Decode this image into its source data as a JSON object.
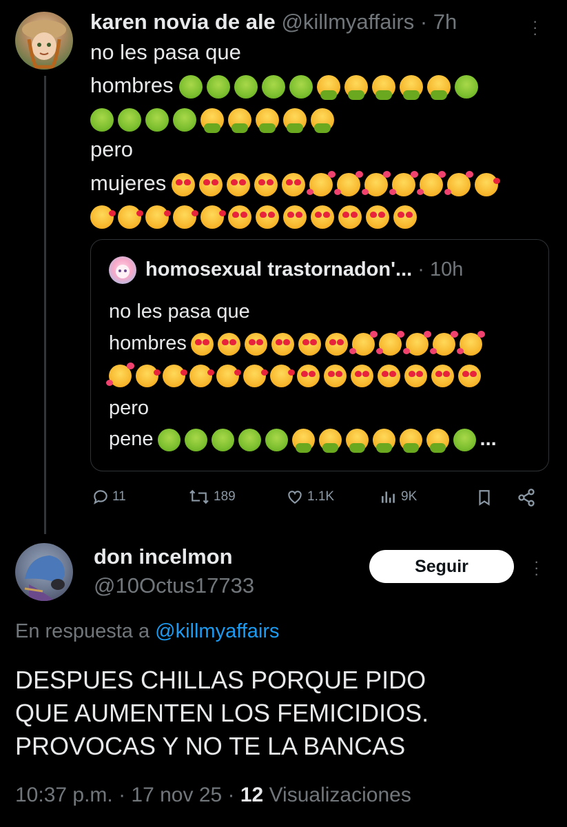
{
  "thread": {
    "author_name": "karen novia de ale",
    "author_handle": "@killmyaffairs",
    "time": "· 7h",
    "lines": [
      "no les pasa que",
      "hombres",
      "pero",
      "mujeres"
    ],
    "emoji_rows": {
      "hombres": [
        "sick",
        "sick",
        "sick",
        "sick",
        "sick",
        "vomit",
        "vomit",
        "vomit",
        "vomit",
        "vomit",
        "sick"
      ],
      "hombres_cont": [
        "sick",
        "sick",
        "sick",
        "sick",
        "vomit",
        "vomit",
        "vomit",
        "vomit",
        "vomit"
      ],
      "mujeres": [
        "heart",
        "heart",
        "heart",
        "heart",
        "heart",
        "party",
        "party",
        "party",
        "party",
        "party",
        "party",
        "kiss"
      ],
      "mujeres_cont": [
        "kiss",
        "kiss",
        "kiss",
        "kiss",
        "kiss",
        "heart",
        "heart",
        "heart",
        "heart",
        "heart",
        "heart",
        "heart"
      ]
    }
  },
  "quote": {
    "author_name": "homosexual trastornadon'...",
    "time": "· 10h",
    "lines": [
      "no les pasa que",
      "hombres",
      "pero",
      "pene"
    ],
    "ellipsis": "...",
    "emoji_rows": {
      "hombres": [
        "heart",
        "heart",
        "heart",
        "heart",
        "heart",
        "heart",
        "party",
        "party",
        "party",
        "party",
        "party"
      ],
      "hombres_cont": [
        "party",
        "kiss",
        "kiss",
        "kiss",
        "kiss",
        "kiss",
        "kiss",
        "heart",
        "heart",
        "heart",
        "heart",
        "heart",
        "heart",
        "heart"
      ],
      "pene": [
        "sick",
        "sick",
        "sick",
        "sick",
        "sick",
        "vomit",
        "vomit",
        "vomit",
        "vomit",
        "vomit",
        "vomit",
        "sick"
      ]
    }
  },
  "actions": {
    "replies": "11",
    "reposts": "189",
    "likes": "1.1K",
    "views": "9K"
  },
  "reply": {
    "author_name": "don incelmon",
    "author_handle": "@10Octus17733",
    "follow_label": "Seguir",
    "reply_to_prefix": "En respuesta a",
    "reply_to_handle": "@killmyaffairs",
    "body_lines": [
      "DESPUES CHILLAS PORQUE PIDO",
      "QUE AUMENTEN LOS FEMICIDIOS.",
      "PROVOCAS Y NO TE LA BANCAS"
    ],
    "timestamp": "10:37 p.m. · 17 nov 25 ·",
    "views_count": "12",
    "views_label": "Visualizaciones"
  },
  "colors": {
    "background": "#000000",
    "text": "#e7e9ea",
    "muted": "#71767b",
    "link": "#1d9bf0",
    "border": "#2f3336"
  }
}
